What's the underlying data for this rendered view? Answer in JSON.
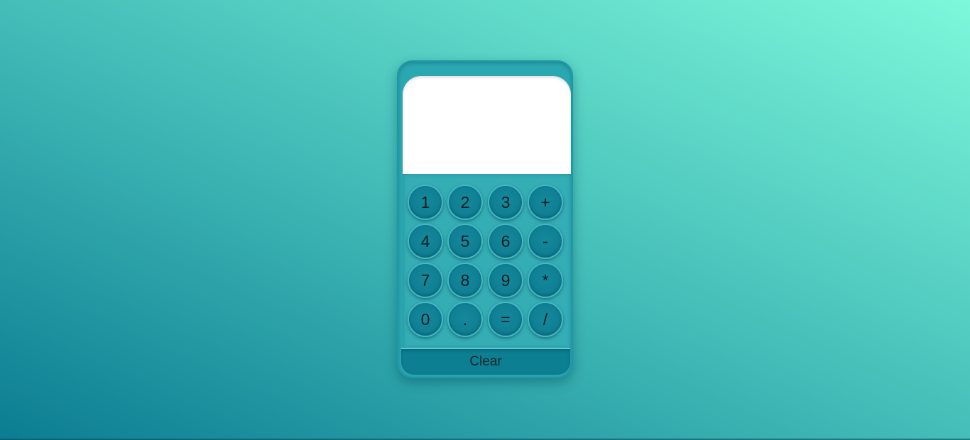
{
  "calculator": {
    "display_value": "",
    "keys": [
      {
        "label": "1",
        "name": "key-1"
      },
      {
        "label": "2",
        "name": "key-2"
      },
      {
        "label": "3",
        "name": "key-3"
      },
      {
        "label": "+",
        "name": "key-plus"
      },
      {
        "label": "4",
        "name": "key-4"
      },
      {
        "label": "5",
        "name": "key-5"
      },
      {
        "label": "6",
        "name": "key-6"
      },
      {
        "label": "-",
        "name": "key-minus"
      },
      {
        "label": "7",
        "name": "key-7"
      },
      {
        "label": "8",
        "name": "key-8"
      },
      {
        "label": "9",
        "name": "key-9"
      },
      {
        "label": "*",
        "name": "key-multiply"
      },
      {
        "label": "0",
        "name": "key-0"
      },
      {
        "label": ".",
        "name": "key-decimal"
      },
      {
        "label": "=",
        "name": "key-equals"
      },
      {
        "label": "/",
        "name": "key-divide"
      }
    ],
    "clear_label": "Clear"
  },
  "colors": {
    "background_start": "#0b7d92",
    "background_end": "#7df8da",
    "body": "#2aa8b2",
    "key": "#0f7f93",
    "display": "#ffffff"
  }
}
